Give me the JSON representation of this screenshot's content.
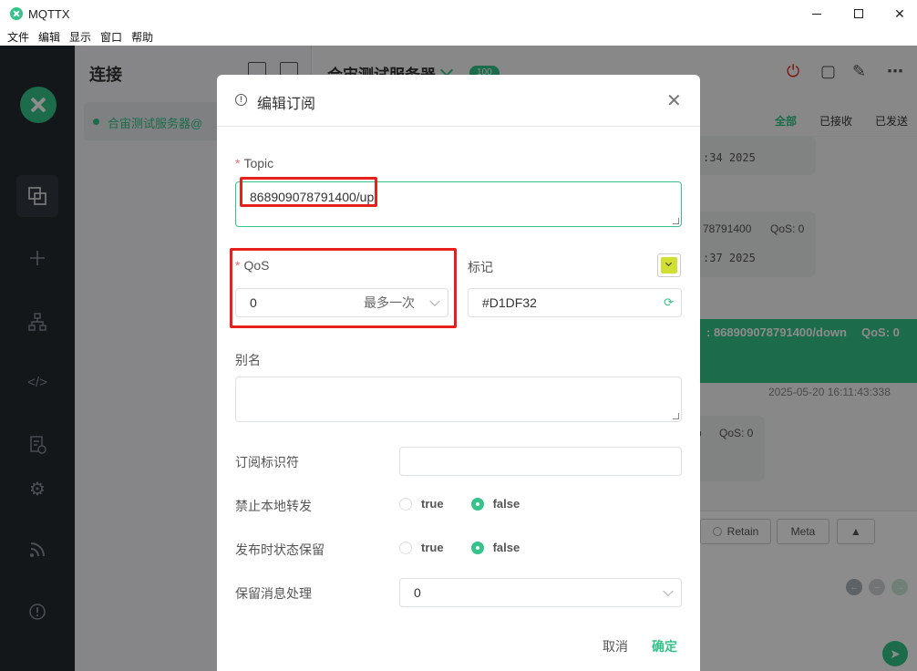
{
  "window": {
    "title": "MQTTX"
  },
  "menu": [
    "文件",
    "编辑",
    "显示",
    "窗口",
    "帮助"
  ],
  "connections": {
    "title": "连接",
    "items": [
      {
        "name": "合宙测试服务器@"
      }
    ]
  },
  "main": {
    "title": "合宙测试服务器",
    "badge": "100",
    "filters": [
      "全部",
      "已接收",
      "已发送"
    ],
    "messages": {
      "time1": ":34 2025",
      "topic_frag": "78791400",
      "qos_frag": "QoS: 0",
      "time2": ":37 2025",
      "out_topic": ": 868909078791400/down",
      "out_qos": "QoS: 0",
      "out_time": "2025-05-20 16:11:43:338",
      "frag3": "p",
      "qos3": "QoS: 0"
    },
    "send": {
      "retain": "Retain",
      "meta": "Meta"
    }
  },
  "dialog": {
    "title": "编辑订阅",
    "topic_label": "Topic",
    "topic_value": "868909078791400/up",
    "qos_label": "QoS",
    "qos_value": "0",
    "qos_desc": "最多一次",
    "tag_label": "标记",
    "color_value": "#D1DF32",
    "alias_label": "别名",
    "alias_value": "",
    "sub_id_label": "订阅标识符",
    "sub_id_value": "",
    "no_local_label": "禁止本地转发",
    "retain_as_published_label": "发布时状态保留",
    "retain_handling_label": "保留消息处理",
    "retain_handling_value": "0",
    "true_label": "true",
    "false_label": "false",
    "cancel": "取消",
    "confirm": "确定"
  },
  "colors": {
    "accent": "#34c388",
    "highlight": "#e5211d",
    "tag": "#D1DF32"
  }
}
